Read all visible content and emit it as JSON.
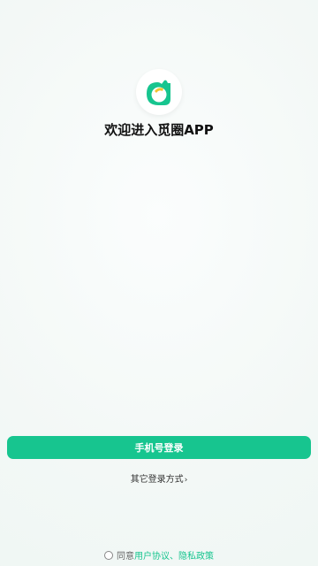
{
  "app": {
    "welcome_text": "欢迎进入觅圈APP",
    "logo_icon": "mi-quan-logo-icon"
  },
  "actions": {
    "phone_login_label": "手机号登录",
    "other_login_label": "其它登录方式",
    "other_login_arrow": "›"
  },
  "agreement": {
    "prefix": "同意",
    "user_agreement": "用户协议",
    "separator": "、",
    "privacy_policy": "隐私政策",
    "checked": false
  },
  "colors": {
    "accent": "#17c58f",
    "logo_yellow": "#f2c230"
  }
}
